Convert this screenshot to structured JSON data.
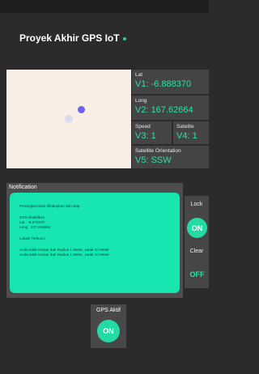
{
  "app": {
    "title": "Proyek Akhir GPS IoT"
  },
  "readings": {
    "lat": {
      "label": "Lat",
      "value": "V1: -6.888370"
    },
    "long": {
      "label": "Long",
      "value": "V2: 167.62664"
    },
    "speed": {
      "label": "Speed",
      "value": "V3: 1"
    },
    "satellite": {
      "label": "Satelite",
      "value": "V4: 1"
    },
    "orientation": {
      "label": "Satellite Orientation",
      "value": "V5: SSW"
    }
  },
  "notification": {
    "title": "Notification",
    "lines": [
      "Perangkat telah dihidupkan dan siap.",
      "GPS Diaktifkan",
      "Lat : -6.870370",
      "Long : 107.626564",
      "Lokasi Terkunci",
      "Anda telah Keluar dari Radius 1 Meter, Jarak 10 Meter",
      "Anda telah Keluar dari Radius 1 Meter, Jarak 10 Meter"
    ]
  },
  "controls": {
    "lock": {
      "label": "Lock",
      "state": "ON"
    },
    "clear": {
      "label": "Clear",
      "state": "OFF"
    },
    "gps": {
      "label": "GPS Aktif",
      "state": "ON"
    }
  },
  "colors": {
    "accent": "#22dba5",
    "value_text": "#2fe0a6",
    "map_bg": "#f8eee5",
    "marker": "#6c63e8"
  }
}
